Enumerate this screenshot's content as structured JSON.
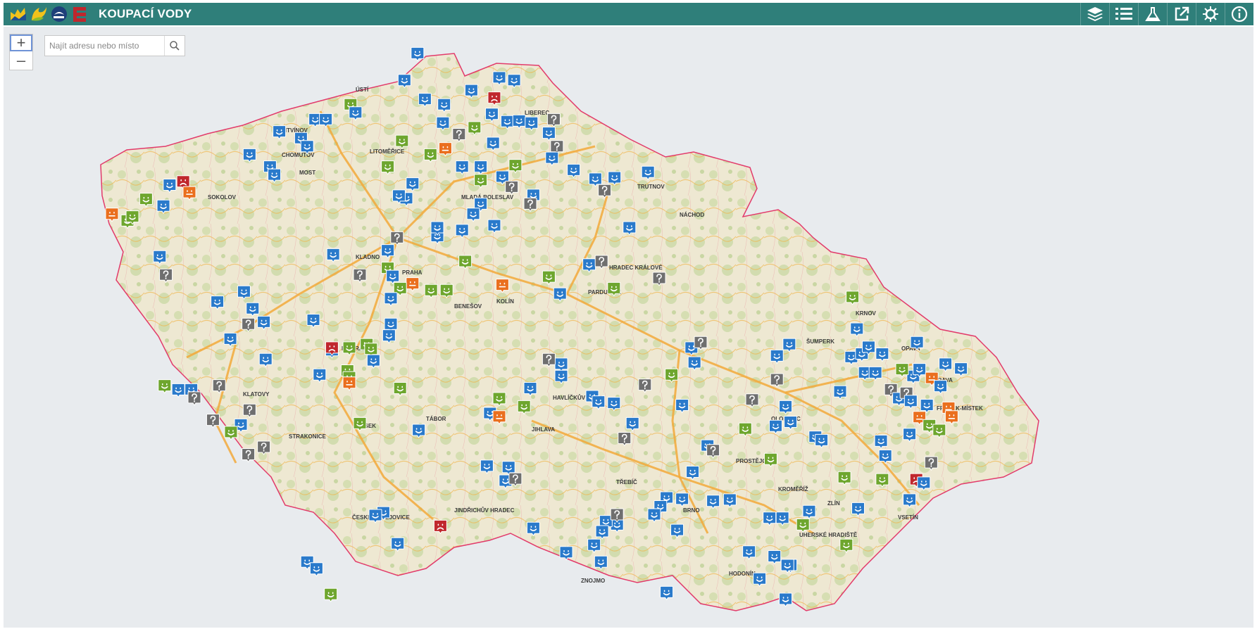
{
  "header": {
    "title": "KOUPACÍ VODY",
    "logo_icons": [
      "logo-hydrology-icon",
      "logo-water-icon",
      "logo-env-icon",
      "logo-health-icon"
    ],
    "tools": [
      {
        "name": "layers-button",
        "icon": "layers-icon"
      },
      {
        "name": "legend-button",
        "icon": "list-icon"
      },
      {
        "name": "analysis-button",
        "icon": "flask-icon"
      },
      {
        "name": "share-button",
        "icon": "external-link-icon"
      },
      {
        "name": "settings-button",
        "icon": "virus-icon"
      },
      {
        "name": "info-button",
        "icon": "info-icon"
      }
    ]
  },
  "map": {
    "zoom_in": "+",
    "zoom_out": "–",
    "search_placeholder": "Najít adresu nebo místo",
    "legend_colors": {
      "good": "#2a7acb",
      "fair": "#6ea62e",
      "poor": "#ea6f1e",
      "bad": "#c0272d",
      "unknown": "#6f6f6f"
    },
    "place_labels": [
      "ÚSTÍ",
      "LITVÍNOV",
      "LITOMĚŘICE",
      "MLADÁ BOLESLAV",
      "KLADNO",
      "PRAHA",
      "KOLÍN",
      "PARDUBICE",
      "HAVLÍČKŮV BROD",
      "JIHLAVA",
      "TÁBOR",
      "PÍSEK",
      "STRAKONICE",
      "KLATOVY",
      "PŘÍBRAM",
      "ČESKÉ BUDĚJOVICE",
      "JINDŘICHŮV HRADEC",
      "TŘEBÍČ",
      "ZNOJMO",
      "BRNO",
      "OLOMOUC",
      "PROSTĚJOV",
      "KROMĚŘÍŽ",
      "ZLÍN",
      "OSTRAVA",
      "OPAVA",
      "KRNOV",
      "ŠUMPERK",
      "HODONÍN",
      "UHERSKÉ HRADIŠTĚ",
      "VSETÍN",
      "FRÝDEK-MÍSTEK",
      "SOKOLOV",
      "CHOMUTOV",
      "LIBEREC",
      "HRADEC KRÁLOVÉ",
      "MOST",
      "BENEŠOV",
      "NÁCHOD",
      "TRUTNOV"
    ]
  }
}
